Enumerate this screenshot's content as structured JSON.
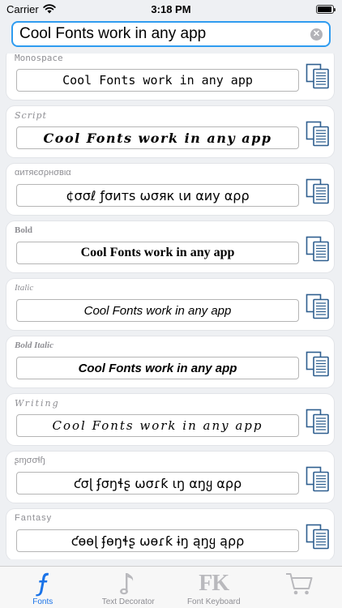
{
  "status": {
    "carrier": "Carrier",
    "time": "3:18 PM",
    "battery_level": 0.95
  },
  "search": {
    "value": "Cool Fonts work in any app",
    "clear_icon": "clear-circle-icon"
  },
  "fonts": [
    {
      "title": "Monospace",
      "sample": "Cool Fonts work in any app"
    },
    {
      "title": "Script",
      "sample": "Cool Fonts work in any app"
    },
    {
      "title": "αитяєσρнσвια",
      "sample": "¢σσℓ ƒσитѕ ωσяк ιи αиу αρρ"
    },
    {
      "title": "Bold",
      "sample": "Cool Fonts work in any app"
    },
    {
      "title": "Italic",
      "sample": "Cool Fonts work in any app"
    },
    {
      "title": "Bold Italic",
      "sample": "Cool Fonts work in any app"
    },
    {
      "title": "Writing",
      "sample": "Cool Fonts work in any app"
    },
    {
      "title": "ʂɱσσɬɧ",
      "sample": "ƈσɭ ʄσŋɬʂ ωσɾƙ ιŋ αŋყ αρρ"
    },
    {
      "title": "Fantasy",
      "sample": "ƈɵɵɭ ʄɵŋɬʂ ωɵɾƙ ɨŋ ąŋყ ąρρ"
    }
  ],
  "tabs": [
    {
      "label": "Fonts",
      "icon": "fonts-f-icon",
      "active": true
    },
    {
      "label": "Text Decorator",
      "icon": "decorator-note-icon",
      "active": false
    },
    {
      "label": "Font Keyboard",
      "icon": "fk-keyboard-icon",
      "active": false
    },
    {
      "label": "",
      "icon": "cart-icon",
      "active": false
    }
  ],
  "colors": {
    "accent": "#2f9cf0",
    "tab_active": "#1a73e8",
    "icon_blue": "#2f5f8f"
  }
}
